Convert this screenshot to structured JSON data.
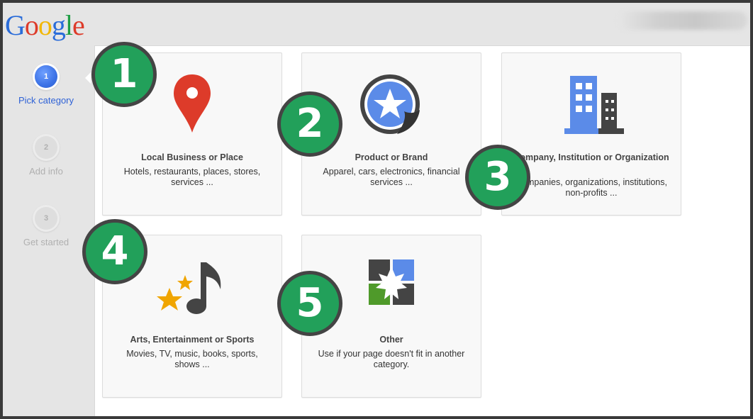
{
  "header": {
    "logo_letters": [
      {
        "char": "G",
        "color": "#2a6cd9"
      },
      {
        "char": "o",
        "color": "#dd3b2a"
      },
      {
        "char": "o",
        "color": "#f2b705"
      },
      {
        "char": "g",
        "color": "#2a6cd9"
      },
      {
        "char": "l",
        "color": "#1f9e45"
      },
      {
        "char": "e",
        "color": "#dd3b2a"
      }
    ]
  },
  "steps": [
    {
      "number": "1",
      "label": "Pick category",
      "state": "active"
    },
    {
      "number": "2",
      "label": "Add info",
      "state": "inactive"
    },
    {
      "number": "3",
      "label": "Get started",
      "state": "inactive"
    }
  ],
  "categories": [
    {
      "title": "Local Business or Place",
      "desc": "Hotels, restaurants, places, stores, services ...",
      "icon": "map-pin-icon"
    },
    {
      "title": "Product or Brand",
      "desc": "Apparel, cars, electronics, financial services ...",
      "icon": "star-sticker-icon"
    },
    {
      "title": "Company, Institution or Organization",
      "desc": "Companies, organizations, institutions, non-profits ...",
      "icon": "building-icon"
    },
    {
      "title": "Arts, Entertainment or Sports",
      "desc": "Movies, TV, music, books, sports, shows ...",
      "icon": "music-stars-icon"
    },
    {
      "title": "Other",
      "desc": "Use if your page doesn't fit in another category.",
      "icon": "puzzle-icon"
    }
  ],
  "annotations": [
    "1",
    "2",
    "3",
    "4",
    "5"
  ],
  "colors": {
    "badge_green": "#22a05a",
    "badge_border": "#444444",
    "active_blue": "#3c72e6",
    "pin_red": "#dd3b2a",
    "building_blue": "#5b8be8",
    "dark_gray": "#444444",
    "star_orange": "#f0a500",
    "puzzle_green": "#4f9a2a"
  }
}
